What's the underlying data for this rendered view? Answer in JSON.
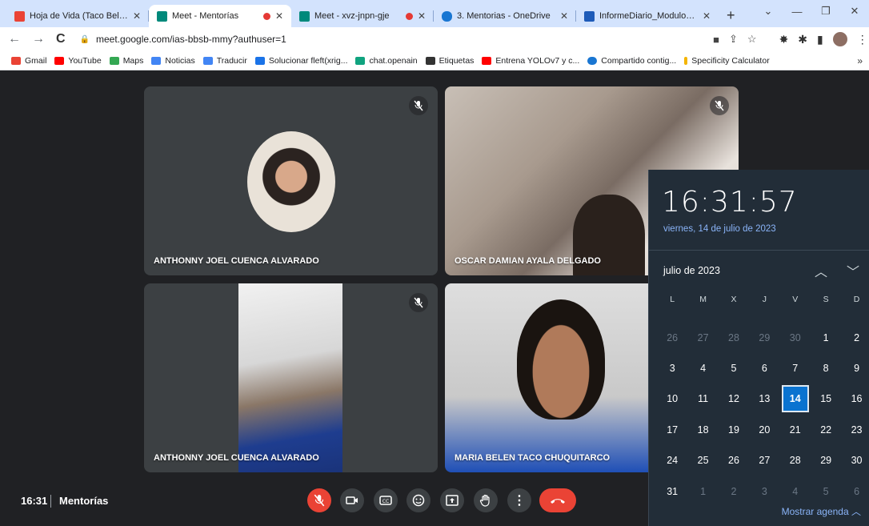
{
  "browser": {
    "tabs": [
      {
        "title": "Hoja de Vida (Taco Belén) - n",
        "favicon_color": "#ea4335",
        "active": false,
        "recording": false
      },
      {
        "title": "Meet - Mentorías",
        "favicon_color": "#00897b",
        "active": true,
        "recording": true
      },
      {
        "title": "Meet - xvz-jnpn-gje",
        "favicon_color": "#00897b",
        "active": false,
        "recording": true
      },
      {
        "title": "3. Mentorias - OneDrive",
        "favicon_color": "#1976d2",
        "active": false,
        "recording": false
      },
      {
        "title": "InformeDiario_ModuloMent",
        "favicon_color": "#1e5bb8",
        "active": false,
        "recording": false
      }
    ],
    "new_tab_label": "+",
    "url": "meet.google.com/ias-bbsb-mmy?authuser=1",
    "bookmarks": [
      {
        "label": "Gmail",
        "color": "#ea4335"
      },
      {
        "label": "YouTube",
        "color": "#ff0000"
      },
      {
        "label": "Maps",
        "color": "#34a853"
      },
      {
        "label": "Noticias",
        "color": "#4285f4"
      },
      {
        "label": "Traducir",
        "color": "#4285f4"
      },
      {
        "label": "Solucionar fleft(xrig...",
        "color": "#1a73e8"
      },
      {
        "label": "chat.openain",
        "color": "#10a37f"
      },
      {
        "label": "Etiquetas",
        "color": "#333333"
      },
      {
        "label": "Entrena YOLOv7 y c...",
        "color": "#ff0000"
      },
      {
        "label": "Compartido contig...",
        "color": "#1976d2"
      },
      {
        "label": "Specificity Calculator",
        "color": "#f4b400"
      }
    ]
  },
  "meet": {
    "participants": [
      {
        "name": "ANTHONNY JOEL CUENCA ALVARADO"
      },
      {
        "name": "OSCAR DAMIAN AYALA DELGADO"
      },
      {
        "name": "ANTHONNY JOEL CUENCA ALVARADO"
      },
      {
        "name": "MARIA BELEN TACO CHUQUITARCO"
      }
    ],
    "clock": "16:31",
    "meeting_title": "Mentorías"
  },
  "calendar": {
    "time": "16:31:57",
    "date": "viernes, 14 de julio de 2023",
    "month_label": "julio de 2023",
    "weekday_headers": [
      "L",
      "M",
      "X",
      "J",
      "V",
      "S",
      "D"
    ],
    "days": [
      "26",
      "27",
      "28",
      "29",
      "30",
      "1",
      "2",
      "3",
      "4",
      "5",
      "6",
      "7",
      "8",
      "9",
      "10",
      "11",
      "12",
      "13",
      "14",
      "15",
      "16",
      "17",
      "18",
      "19",
      "20",
      "21",
      "22",
      "23",
      "24",
      "25",
      "26",
      "27",
      "28",
      "29",
      "30",
      "31",
      "1",
      "2",
      "3",
      "4",
      "5",
      "6"
    ],
    "today": "14",
    "agenda_label": "Mostrar agenda"
  },
  "colors": {
    "accent": "#0a73d0",
    "hangup": "#ea4335",
    "link": "#8ab4f8"
  }
}
